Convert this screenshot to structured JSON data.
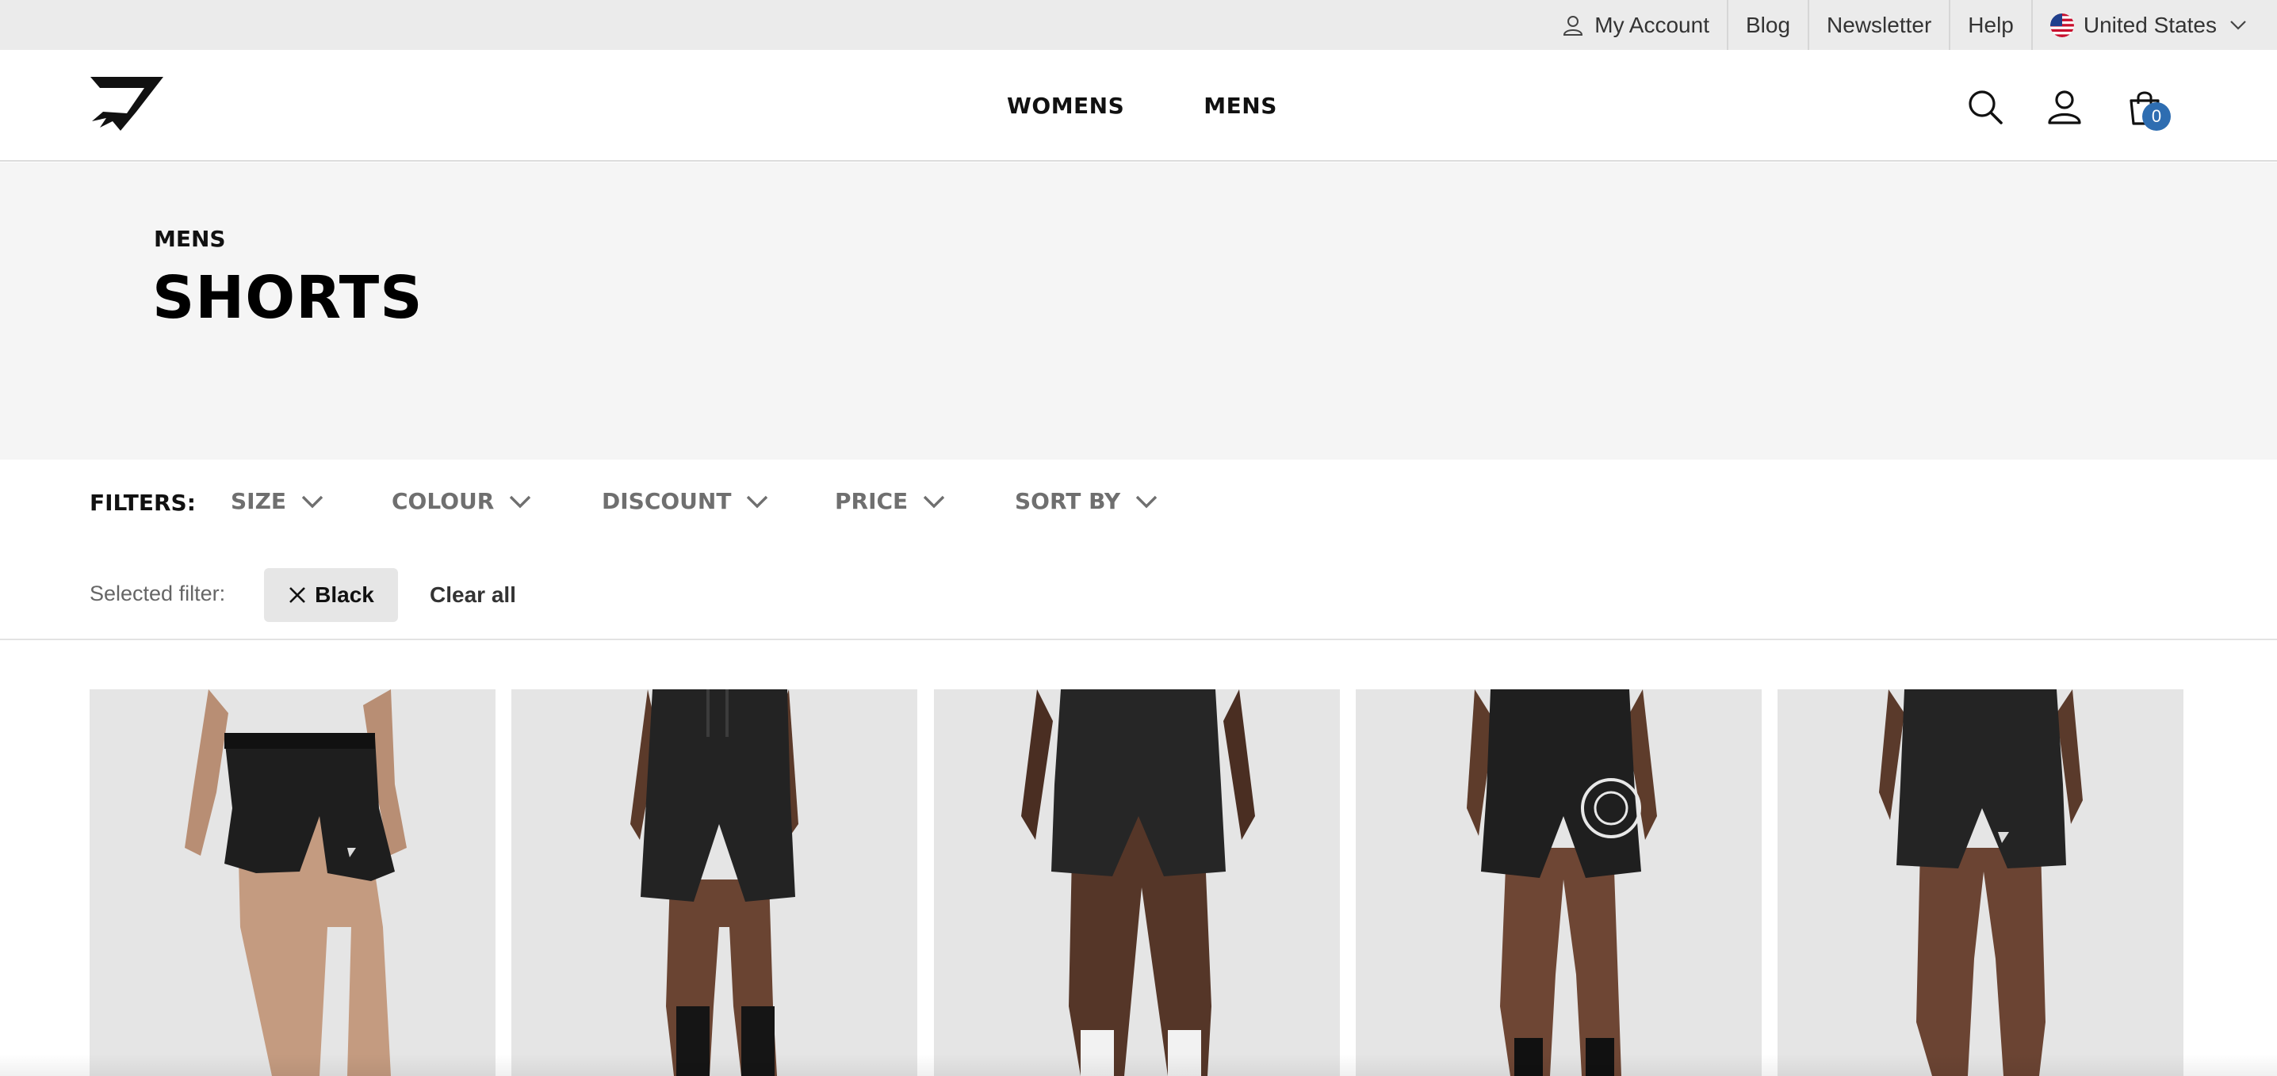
{
  "utility_bar": {
    "account": "My Account",
    "blog": "Blog",
    "newsletter": "Newsletter",
    "help": "Help",
    "region": "United States"
  },
  "header": {
    "nav": [
      "WOMENS",
      "MENS"
    ],
    "cart_count": "0"
  },
  "hero": {
    "breadcrumb": "MENS",
    "title": "SHORTS"
  },
  "filters": {
    "label": "FILTERS:",
    "options": [
      "SIZE",
      "COLOUR",
      "DISCOUNT",
      "PRICE",
      "SORT BY"
    ]
  },
  "selected_filters": {
    "label": "Selected filter:",
    "chips": [
      "Black"
    ],
    "clear_label": "Clear all"
  },
  "products": [
    {
      "image": "black-shorts-model-1"
    },
    {
      "image": "black-shorts-model-2"
    },
    {
      "image": "black-shorts-model-3"
    },
    {
      "image": "black-shorts-model-4"
    },
    {
      "image": "black-shorts-model-5"
    }
  ],
  "colors": {
    "utility_bg": "#ebebeb",
    "hero_bg": "#f5f5f5",
    "cart_badge": "#2e6db1",
    "filter_text": "#6f6f6f",
    "chip_bg": "#e6e6e6",
    "product_bg": "#e5e5e5"
  }
}
